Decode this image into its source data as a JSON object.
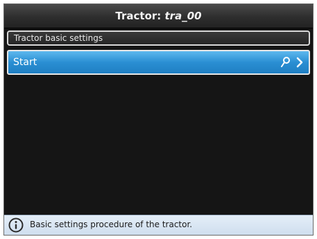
{
  "header": {
    "title_prefix": "Tractor: ",
    "title_value": "tra_00"
  },
  "section": {
    "label": "Tractor basic settings"
  },
  "menu": {
    "items": [
      {
        "label": "Start",
        "icons": [
          "pin-icon",
          "chevron-right-icon"
        ]
      }
    ]
  },
  "status": {
    "icon": "info-icon",
    "message": "Basic settings procedure of the tractor."
  },
  "colors": {
    "accent": "#2a8fd3",
    "background": "#151515",
    "status_bar": "#dbe7f3"
  }
}
